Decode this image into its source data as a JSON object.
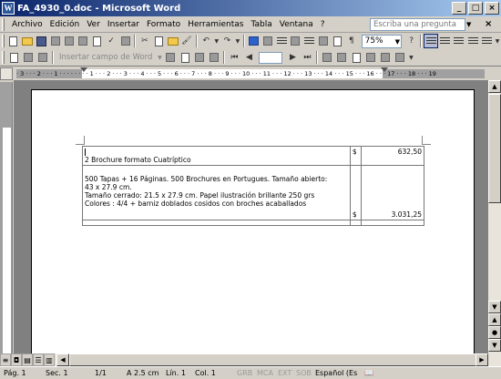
{
  "window": {
    "title": "FA_4930_0.doc - Microsoft Word",
    "app_icon": "W"
  },
  "menu": {
    "items": [
      "Archivo",
      "Edición",
      "Ver",
      "Insertar",
      "Formato",
      "Herramientas",
      "Tabla",
      "Ventana",
      "?"
    ],
    "ask_placeholder": "Escriba una pregunta"
  },
  "toolbar": {
    "zoom": "75%",
    "field_label": "Insertar campo de Word"
  },
  "ruler": {
    "numbers": "· 3 · · · 2 · · · 1 · · · · · · · · 1 · · · 2 · · · 3 · · · 4 · · · 5 · · · 6 · · · 7 · · · 8 · · · 9 · · · 10 · · · 11 · · · 12 · · · 13 · · · 14 · · · 15 · · · 16 · · · 17 · · · 18 · · · 19"
  },
  "document": {
    "rows": [
      {
        "description": "2 Brochure formato Cuatríptico",
        "currency": "$",
        "amount": "632,50"
      },
      {
        "lines": [
          "500 Tapas + 16 Páginas. 500 Brochures en Portugues. Tamaño abierto:",
          "43 x 27.9 cm.",
          "Tamaño cerrado: 21.5 x 27.9 cm. Papel ilustración brillante 250 grs",
          "Colores : 4/4 + barniz doblados cosidos con broches acaballados"
        ],
        "currency": "$",
        "amount": "3.031,25"
      }
    ]
  },
  "status": {
    "page": "Pág. 1",
    "section": "Sec. 1",
    "pages": "1/1",
    "at": "A 2.5 cm",
    "line": "Lín. 1",
    "col": "Col. 1",
    "grb": "GRB",
    "mca": "MCA",
    "ext": "EXT",
    "sob": "SOB",
    "language": "Español (Es"
  }
}
